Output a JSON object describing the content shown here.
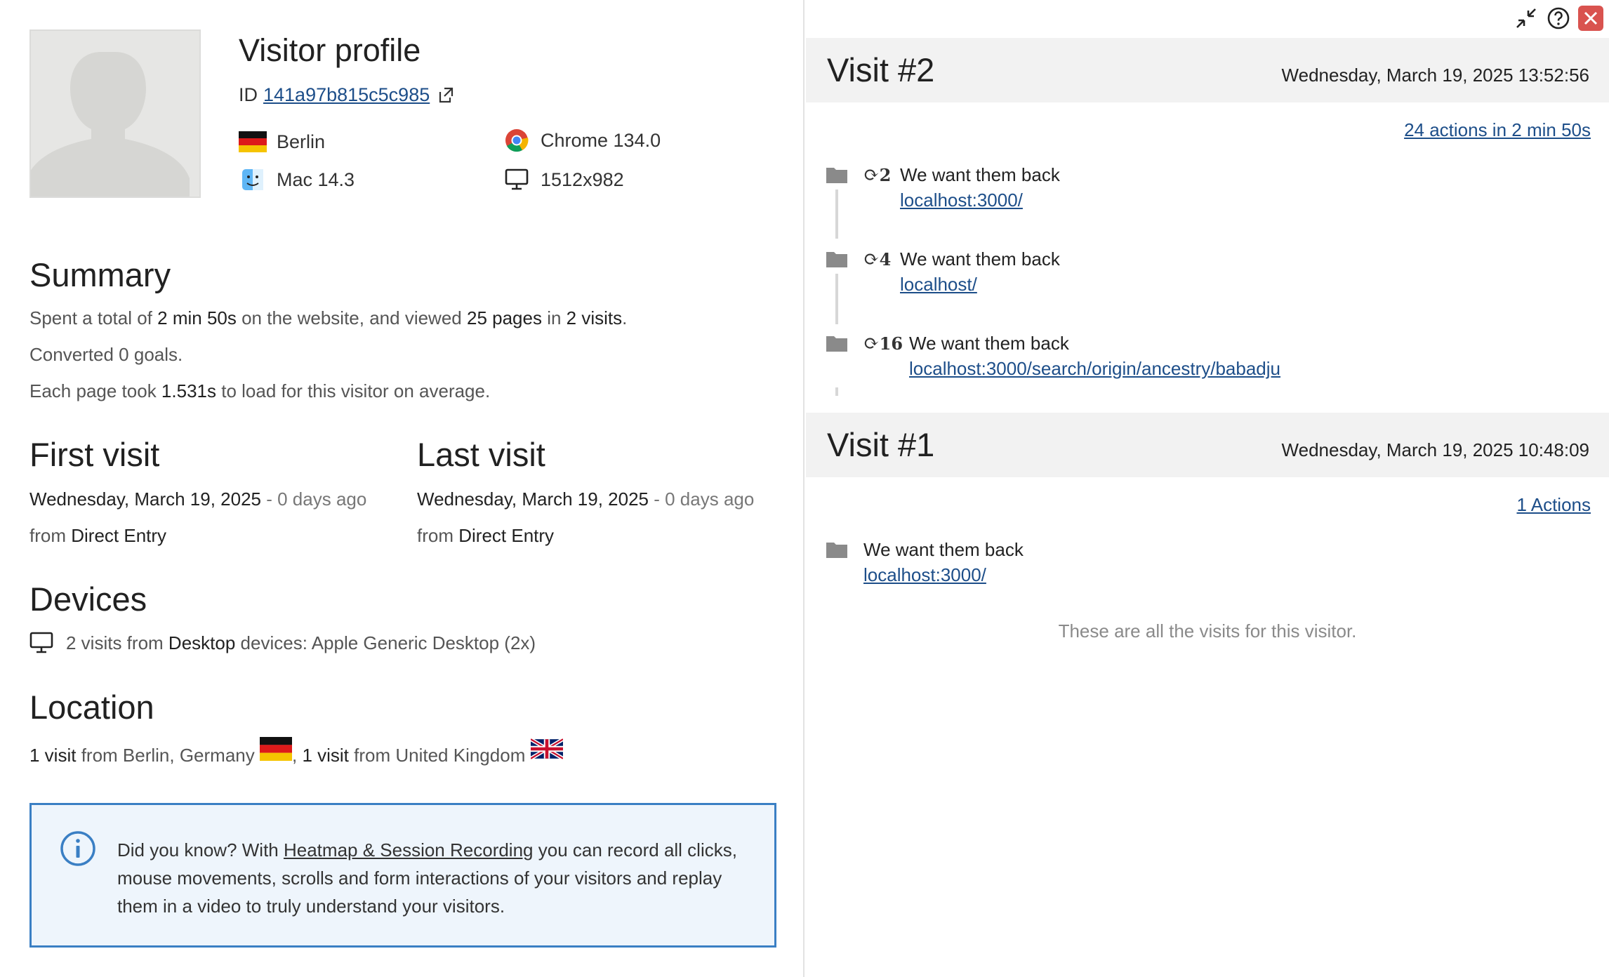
{
  "profile": {
    "title": "Visitor profile",
    "id_label": "ID",
    "visitor_id": "141a97b815c5c985",
    "city": "Berlin",
    "browser": "Chrome 134.0",
    "os": "Mac 14.3",
    "resolution": "1512x982",
    "icons": {
      "avatar": "avatar-silhouette",
      "copy": "copy-icon",
      "flag": "germany-flag",
      "browser": "chrome-icon",
      "os": "macos-finder-icon",
      "device": "desktop-icon"
    }
  },
  "summary": {
    "heading": "Summary",
    "spent_prefix": "Spent a total of ",
    "spent_time": "2 min 50s",
    "spent_mid": " on the website, and viewed ",
    "pages": "25 pages",
    "in_word": " in ",
    "visits": "2 visits",
    "period": ".",
    "converted": "Converted 0 goals.",
    "load_prefix": "Each page took ",
    "load_time": "1.531s",
    "load_suffix": " to load for this visitor on average."
  },
  "first_visit": {
    "heading": "First visit",
    "date": "Wednesday, March 19, 2025",
    "ago": " - 0 days ago",
    "from_word": "from ",
    "source": "Direct Entry"
  },
  "last_visit": {
    "heading": "Last visit",
    "date": "Wednesday, March 19, 2025",
    "ago": " - 0 days ago",
    "from_word": "from ",
    "source": "Direct Entry"
  },
  "devices": {
    "heading": "Devices",
    "count": "2 visits from ",
    "type": "Desktop",
    "suffix": " devices: Apple Generic Desktop (2x)"
  },
  "location": {
    "heading": "Location",
    "visit1": "1 visit",
    "from1": " from Berlin, Germany ",
    "sep": ", ",
    "visit2": "1 visit",
    "from2": " from United Kingdom "
  },
  "info": {
    "prefix": "Did you know? With ",
    "link": "Heatmap & Session Recording",
    "suffix": " you can record all clicks, mouse movements, scrolls and form interactions of your visitors and replay them in a video to truly understand your visitors."
  },
  "window": {
    "minimize_icon": "collapse-arrows-icon",
    "help_icon": "help-circle-icon",
    "close_icon": "close-icon",
    "close_color": "#d9534f"
  },
  "visits": [
    {
      "title": "Visit #2",
      "date": "Wednesday, March 19, 2025 13:52:56",
      "actions_summary": "24 actions in 2 min 50s",
      "actions": [
        {
          "refresh_count": "2",
          "title": "We want them back",
          "url": "localhost:3000/"
        },
        {
          "refresh_count": "4",
          "title": "We want them back",
          "url": "localhost/"
        },
        {
          "refresh_count": "16",
          "title": "We want them back",
          "url": "localhost:3000/search/origin/ancestry/babadju"
        }
      ]
    },
    {
      "title": "Visit #1",
      "date": "Wednesday, March 19, 2025 10:48:09",
      "actions_summary": "1 Actions",
      "actions": [
        {
          "title": "We want them back",
          "url": "localhost:3000/"
        }
      ]
    }
  ],
  "footer_note": "These are all the visits for this visitor.",
  "colors": {
    "link": "#1d4e89",
    "info_border": "#3a7fc4",
    "info_bg": "#eef5fc",
    "visit_bar": "#f2f2f2"
  }
}
